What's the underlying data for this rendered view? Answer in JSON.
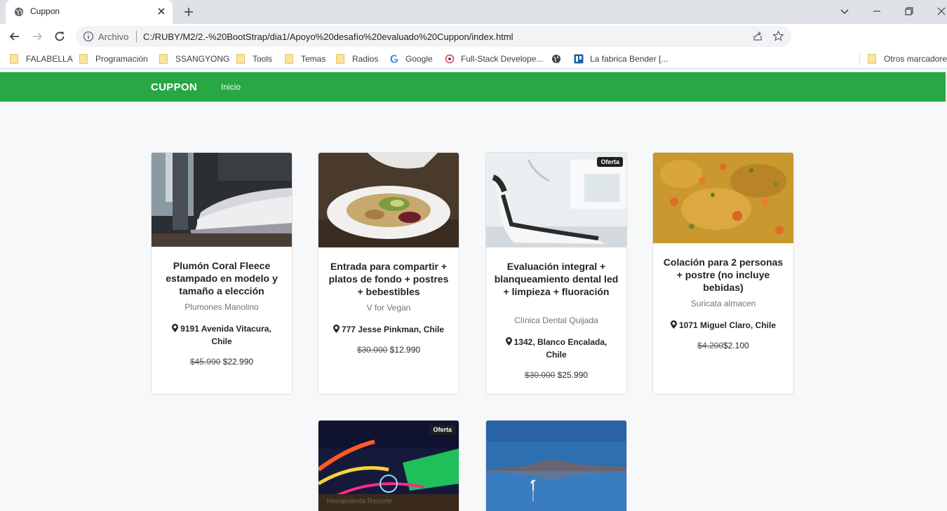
{
  "browser": {
    "tab_title": "Cuppon",
    "protocol_label": "Archivo",
    "url": "C:/RUBY/M2/2.-%20BootStrap/dia1/Apoyo%20desafío%20evaluado%20Cuppon/index.html",
    "bookmarks": [
      "FALABELLA",
      "Programación",
      "SSANGYONG",
      "Tools",
      "Temas",
      "Radios",
      "Google",
      "Full-Stack Develope...",
      "La fabrica Bender [...",
      "Otros marcadore"
    ]
  },
  "navbar": {
    "brand": "CUPPON",
    "link": "Inicio",
    "color": "#28a745"
  },
  "cards": [
    {
      "image": "bedroom",
      "title": "Plumón Coral Fleece estampado en modelo y tamaño a elección",
      "shop": "Plumones Manolino",
      "address": "9191 Avenida Vitacura, Chile",
      "old_price": "$45.990",
      "price": "$22.990"
    },
    {
      "image": "vegan-dish",
      "title": "Entrada para compartir + platos de fondo + postres + bebestibles",
      "shop": "V for Vegan",
      "address": "777 Jesse Pinkman, Chile",
      "old_price": "$30.000",
      "price": "$12.990"
    },
    {
      "image": "dental-chair",
      "badge": "Oferta",
      "title": "Evaluación integral + blanqueamiento dental led + limpieza + fluoración",
      "shop": "Clínica Dental Quijada",
      "address": "1342, Blanco Encalada, Chile",
      "old_price": "$30.000",
      "price": "$25.990"
    },
    {
      "image": "food-stew",
      "title": "Colación para 2 personas + postre (no incluye bebidas)",
      "shop": "Suricata almacen",
      "address": "1071 Miguel Claro, Chile",
      "old_price": "$4.200",
      "price": "$2.100"
    },
    {
      "image": "fair-lights",
      "badge": "Oferta",
      "overlay_text": "Herramienta Recorte"
    },
    {
      "image": "salt-flat-lake"
    }
  ]
}
